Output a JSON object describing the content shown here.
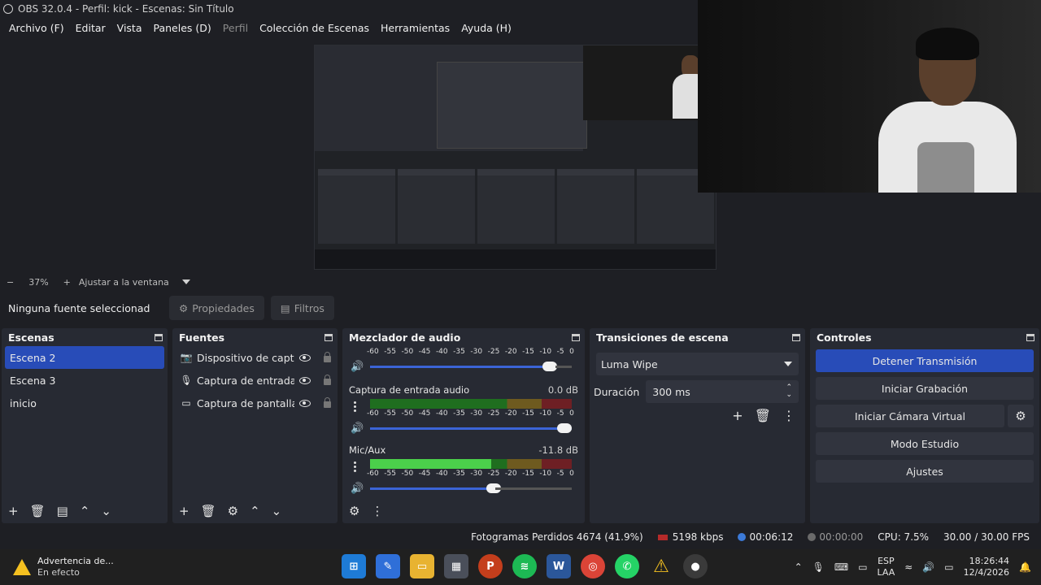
{
  "window": {
    "title": "OBS 32.0.4 - Perfil: kick - Escenas: Sin Título"
  },
  "menu": [
    {
      "label": "Archivo (F)",
      "enabled": true
    },
    {
      "label": "Editar",
      "enabled": true
    },
    {
      "label": "Vista",
      "enabled": true
    },
    {
      "label": "Paneles (D)",
      "enabled": true
    },
    {
      "label": "Perfil",
      "enabled": false
    },
    {
      "label": "Colección de Escenas",
      "enabled": true
    },
    {
      "label": "Herramientas",
      "enabled": true
    },
    {
      "label": "Ayuda (H)",
      "enabled": true
    }
  ],
  "zoom": {
    "value": "37%",
    "fit_label": "Ajustar a la ventana",
    "minus": "−",
    "plus": "+"
  },
  "properties_bar": {
    "no_source": "Ninguna fuente seleccionad",
    "properties_label": "Propiedades",
    "filters_label": "Filtros"
  },
  "scenes": {
    "title": "Escenas",
    "items": [
      "Escena 2",
      "Escena 3",
      "inicio"
    ],
    "selected": 0
  },
  "sources": {
    "title": "Fuentes",
    "items": [
      {
        "name": "Dispositivo de captura",
        "icon": "camera-icon"
      },
      {
        "name": "Captura de entrada a",
        "icon": "microphone-icon"
      },
      {
        "name": "Captura de pantalla",
        "icon": "monitor-icon"
      }
    ]
  },
  "mixer": {
    "title": "Mezclador de audio",
    "scale": [
      "-60",
      "-55",
      "-50",
      "-45",
      "-40",
      "-35",
      "-30",
      "-25",
      "-20",
      "-15",
      "-10",
      "-5",
      "0"
    ],
    "channels": [
      {
        "name": "",
        "db": "",
        "level": 0,
        "volume": 0.92
      },
      {
        "name": "Captura de entrada audio",
        "db": "0.0 dB",
        "level": 0,
        "volume": 1.0
      },
      {
        "name": "Mic/Aux",
        "db": "-11.8 dB",
        "level": 0.6,
        "volume": 0.62
      }
    ]
  },
  "transitions": {
    "title": "Transiciones de escena",
    "selected": "Luma Wipe",
    "duration_label": "Duración",
    "duration_value": "300 ms"
  },
  "controls": {
    "title": "Controles",
    "stop_stream": "Detener Transmisión",
    "start_recording": "Iniciar Grabación",
    "virtual_cam": "Iniciar Cámara Virtual",
    "studio_mode": "Modo Estudio",
    "settings": "Ajustes"
  },
  "status": {
    "dropped_frames": "Fotogramas Perdidos 4674 (41.9%)",
    "bitrate": "5198 kbps",
    "stream_time": "00:06:12",
    "rec_time": "00:00:00",
    "cpu": "CPU: 7.5%",
    "fps": "30.00 / 30.00 FPS"
  },
  "taskbar": {
    "warning_title": "Advertencia de...",
    "warning_sub": "En efecto",
    "lang_top": "ESP",
    "lang_bottom": "LAA",
    "time": "18:26:44",
    "date": "12/4/2026"
  },
  "colors": {
    "accent": "#284cb8",
    "dock_bg": "#272a33",
    "app_bg": "#1e1f24"
  }
}
